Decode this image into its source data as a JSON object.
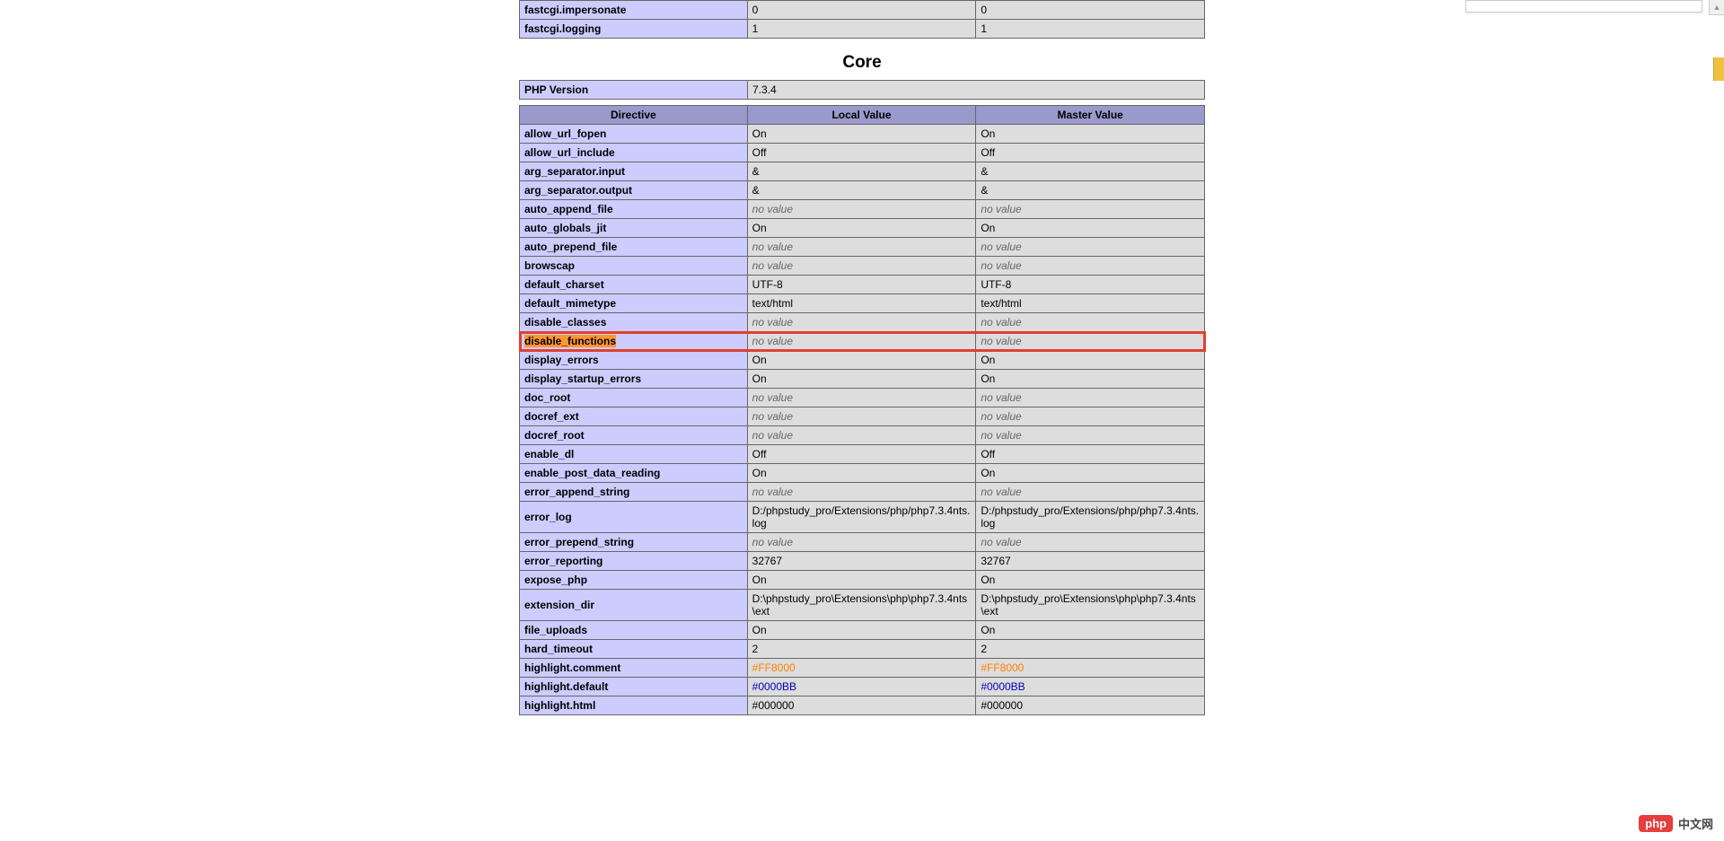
{
  "top_table": {
    "rows": [
      {
        "name": "fastcgi.impersonate",
        "local": "0",
        "master": "0"
      },
      {
        "name": "fastcgi.logging",
        "local": "1",
        "master": "1"
      }
    ]
  },
  "section_title": "Core",
  "version_row": {
    "name": "PHP Version",
    "value": "7.3.4"
  },
  "headers": {
    "directive": "Directive",
    "local": "Local Value",
    "master": "Master Value"
  },
  "directives": [
    {
      "name": "allow_url_fopen",
      "local": "On",
      "master": "On"
    },
    {
      "name": "allow_url_include",
      "local": "Off",
      "master": "Off"
    },
    {
      "name": "arg_separator.input",
      "local": "&",
      "master": "&"
    },
    {
      "name": "arg_separator.output",
      "local": "&",
      "master": "&"
    },
    {
      "name": "auto_append_file",
      "local": "no value",
      "master": "no value",
      "novalue": true
    },
    {
      "name": "auto_globals_jit",
      "local": "On",
      "master": "On"
    },
    {
      "name": "auto_prepend_file",
      "local": "no value",
      "master": "no value",
      "novalue": true
    },
    {
      "name": "browscap",
      "local": "no value",
      "master": "no value",
      "novalue": true
    },
    {
      "name": "default_charset",
      "local": "UTF-8",
      "master": "UTF-8"
    },
    {
      "name": "default_mimetype",
      "local": "text/html",
      "master": "text/html"
    },
    {
      "name": "disable_classes",
      "local": "no value",
      "master": "no value",
      "novalue": true
    },
    {
      "name": "disable_functions",
      "local": "no value",
      "master": "no value",
      "novalue": true,
      "highlight": true,
      "mark": true
    },
    {
      "name": "display_errors",
      "local": "On",
      "master": "On"
    },
    {
      "name": "display_startup_errors",
      "local": "On",
      "master": "On"
    },
    {
      "name": "doc_root",
      "local": "no value",
      "master": "no value",
      "novalue": true
    },
    {
      "name": "docref_ext",
      "local": "no value",
      "master": "no value",
      "novalue": true
    },
    {
      "name": "docref_root",
      "local": "no value",
      "master": "no value",
      "novalue": true
    },
    {
      "name": "enable_dl",
      "local": "Off",
      "master": "Off"
    },
    {
      "name": "enable_post_data_reading",
      "local": "On",
      "master": "On"
    },
    {
      "name": "error_append_string",
      "local": "no value",
      "master": "no value",
      "novalue": true
    },
    {
      "name": "error_log",
      "local": "D:/phpstudy_pro/Extensions/php/php7.3.4nts.log",
      "master": "D:/phpstudy_pro/Extensions/php/php7.3.4nts.log"
    },
    {
      "name": "error_prepend_string",
      "local": "no value",
      "master": "no value",
      "novalue": true
    },
    {
      "name": "error_reporting",
      "local": "32767",
      "master": "32767"
    },
    {
      "name": "expose_php",
      "local": "On",
      "master": "On"
    },
    {
      "name": "extension_dir",
      "local": "D:\\phpstudy_pro\\Extensions\\php\\php7.3.4nts\\ext",
      "master": "D:\\phpstudy_pro\\Extensions\\php\\php7.3.4nts\\ext"
    },
    {
      "name": "file_uploads",
      "local": "On",
      "master": "On"
    },
    {
      "name": "hard_timeout",
      "local": "2",
      "master": "2"
    },
    {
      "name": "highlight.comment",
      "local": "#FF8000",
      "master": "#FF8000",
      "colorclass": "color-orange"
    },
    {
      "name": "highlight.default",
      "local": "#0000BB",
      "master": "#0000BB",
      "colorclass": "color-blue"
    },
    {
      "name": "highlight.html",
      "local": "#000000",
      "master": "#000000",
      "colorclass": "color-black"
    }
  ],
  "watermark": {
    "badge": "php",
    "text": "中文网"
  }
}
